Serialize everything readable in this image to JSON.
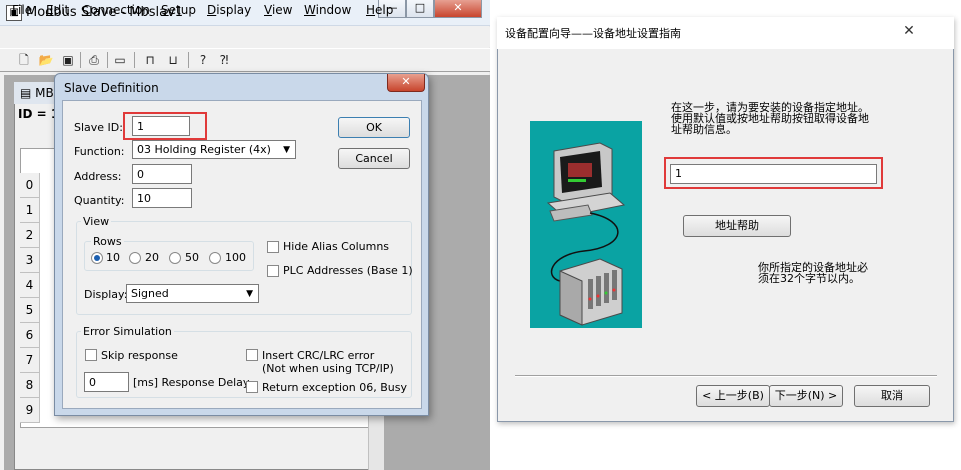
{
  "main_window": {
    "title": "Modbus Slave - Mbslav1",
    "title_icon": "modbus-app-icon",
    "caption": {
      "min_glyph": "—",
      "max_glyph": "□",
      "close_glyph": "✕"
    },
    "menu": [
      {
        "key": "F",
        "rest": "ile"
      },
      {
        "key": "E",
        "rest": "dit"
      },
      {
        "key": "C",
        "rest": "onnection"
      },
      {
        "key": "S",
        "rest": "etup"
      },
      {
        "key": "D",
        "rest": "isplay"
      },
      {
        "key": "V",
        "rest": "iew"
      },
      {
        "key": "W",
        "rest": "indow"
      },
      {
        "key": "H",
        "rest": "elp"
      }
    ],
    "toolbar_icons": [
      "new-file-icon",
      "open-folder-icon",
      "save-icon",
      "print-icon",
      "window-icon",
      "connect-icon",
      "disconnect-icon",
      "help-icon",
      "context-help-icon"
    ],
    "child_window": {
      "title_fragment": "MB",
      "id_line": "ID = 1",
      "row_numbers": [
        "0",
        "1",
        "2",
        "3",
        "4",
        "5",
        "6",
        "7",
        "8",
        "9"
      ]
    }
  },
  "slave_dialog": {
    "title": "Slave Definition",
    "close_glyph": "✕",
    "slave_id_label": "Slave ID:",
    "slave_id_value": "1",
    "function_label": "Function:",
    "function_value": "03 Holding Register (4x)",
    "address_label": "Address:",
    "address_value": "0",
    "quantity_label": "Quantity:",
    "quantity_value": "10",
    "ok_label": "OK",
    "cancel_label": "Cancel",
    "view_group": {
      "title": "View",
      "rows_label": "Rows",
      "row_options": [
        "10",
        "20",
        "50",
        "100"
      ],
      "selected_row": "10",
      "hide_alias_label": "Hide Alias Columns",
      "plc_addresses_label": "PLC Addresses (Base 1)",
      "display_label": "Display:",
      "display_value": "Signed"
    },
    "error_group": {
      "title": "Error Simulation",
      "skip_response_label": "Skip response",
      "delay_value": "0",
      "delay_label": "[ms] Response Delay",
      "crc_label_line1": "Insert CRC/LRC error",
      "crc_label_line2": "(Not when using TCP/IP)",
      "return_exception_label": "Return exception 06, Busy"
    }
  },
  "wizard": {
    "title": "设备配置向导——设备地址设置指南",
    "close_glyph": "✕",
    "description_line1": "在这一步，请为要安装的设备指定地址。",
    "description_line2": "使用默认值或按地址帮助按钮取得设备地",
    "description_line3": "址帮助信息。",
    "address_value": "1",
    "help_button": "地址帮助",
    "note_line1": "你所指定的设备地址必",
    "note_line2": "须在32个字节以内。",
    "back_button": "< 上一步(B)",
    "next_button": "下一步(N) >",
    "cancel_button": "取消"
  },
  "colors": {
    "highlight_box": "#e03a3a",
    "illustration_bg": "#0aa3a3"
  }
}
